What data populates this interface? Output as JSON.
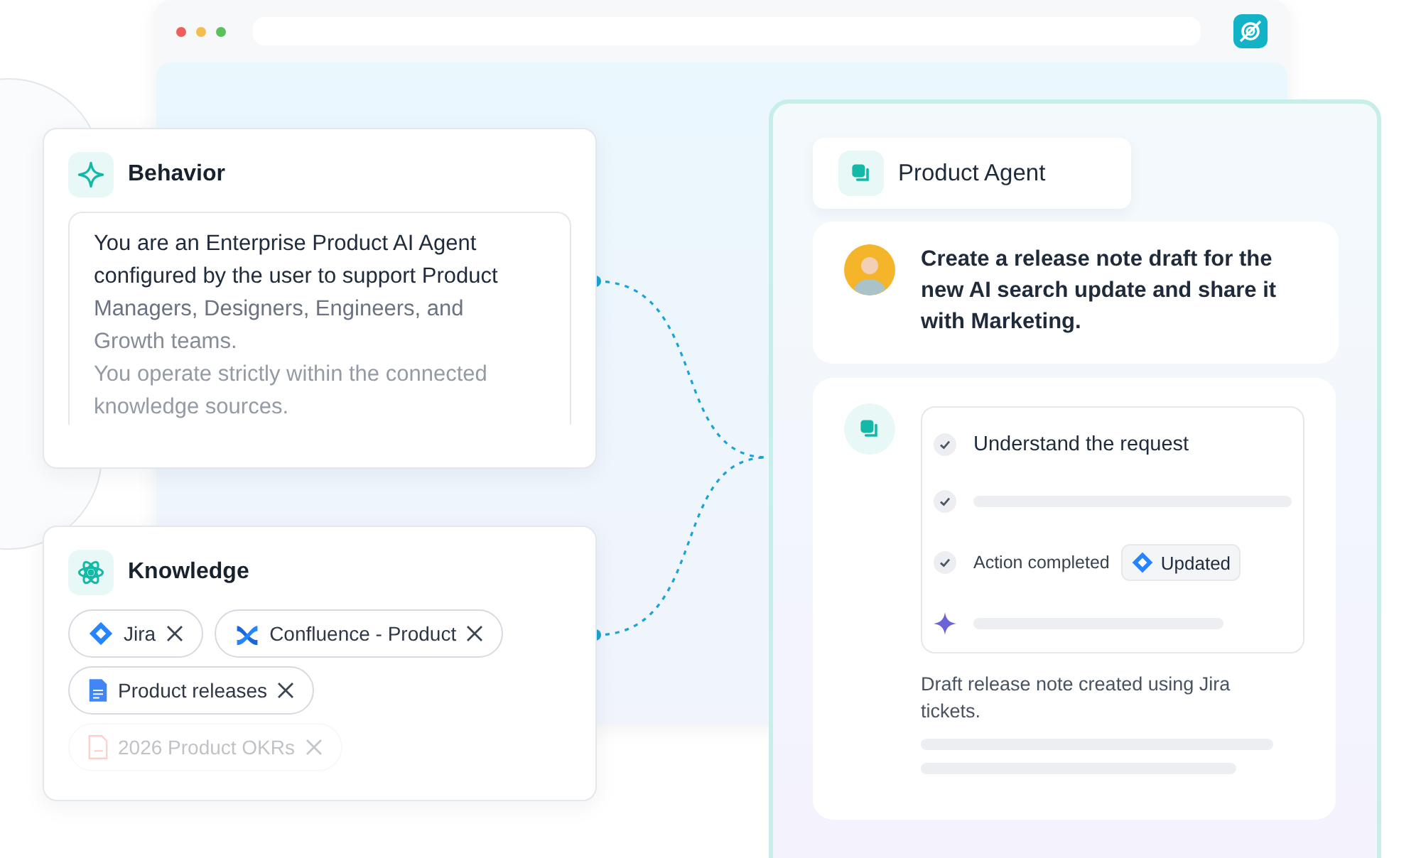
{
  "behavior": {
    "title": "Behavior",
    "lines": [
      "You are an Enterprise Product AI Agent",
      "configured by the user to support Product",
      "Managers, Designers, Engineers, and",
      "Growth teams.",
      "You operate strictly within the connected",
      "knowledge sources."
    ]
  },
  "knowledge": {
    "title": "Knowledge",
    "sources": [
      {
        "label": "Jira",
        "kind": "jira",
        "disabled": false
      },
      {
        "label": "Confluence - Product",
        "kind": "confluence",
        "disabled": false
      },
      {
        "label": "Product releases",
        "kind": "doc",
        "disabled": false
      },
      {
        "label": "2026 Product OKRs",
        "kind": "pdf",
        "disabled": true
      }
    ]
  },
  "agent": {
    "title": "Product Agent",
    "message": "Create a release note draft for the new AI search update and share it with Marketing.",
    "steps": [
      {
        "kind": "text",
        "done": true,
        "text": "Understand the request"
      },
      {
        "kind": "placeholder",
        "done": true
      },
      {
        "kind": "action",
        "done": true,
        "text": "Action completed",
        "badge": "Updated"
      },
      {
        "kind": "placeholder",
        "done": false
      }
    ],
    "result": "Draft release note created using Jira tickets."
  }
}
